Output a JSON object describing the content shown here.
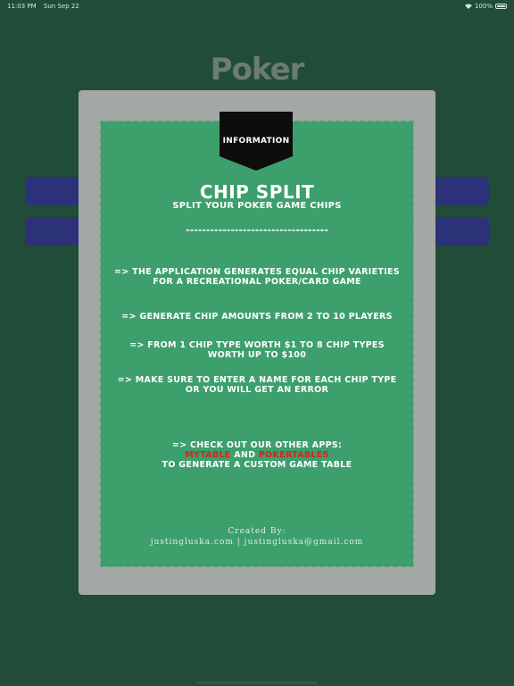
{
  "status_bar": {
    "time": "11:03 PM",
    "date": "Sun Sep 22",
    "battery": "100%"
  },
  "app": {
    "title": "Poker"
  },
  "info": {
    "tag": "INFORMATION",
    "title": "CHIP SPLIT",
    "subtitle": "SPLIT YOUR POKER GAME CHIPS",
    "divider": "-----------------------------------",
    "line1": "=> THE APPLICATION GENERATES EQUAL CHIP VARIETIES FOR A RECREATIONAL POKER/CARD GAME",
    "line2": "=> GENERATE CHIP AMOUNTS FROM 2 TO 10 PLAYERS",
    "line3": "=> FROM 1 CHIP TYPE WORTH $1 TO 8 CHIP TYPES WORTH UP TO $100",
    "line4": "=> MAKE SURE TO ENTER A NAME FOR EACH CHIP TYPE OR YOU WILL GET AN ERROR",
    "apps_intro": "=> CHECK OUT OUR OTHER APPS:",
    "app1": "MYTABLE",
    "and": " AND ",
    "app2": "POKERTABLES",
    "apps_outro": "TO GENERATE A CUSTOM GAME TABLE",
    "created_by": "Created By:",
    "contact": "justingluska.com | justingluska@gmail.com"
  },
  "colors": {
    "background": "#204c38",
    "modal": "#a3a8a5",
    "card": "#3d9f6c",
    "button": "#2b3278",
    "accent_red": "#d8231f"
  }
}
